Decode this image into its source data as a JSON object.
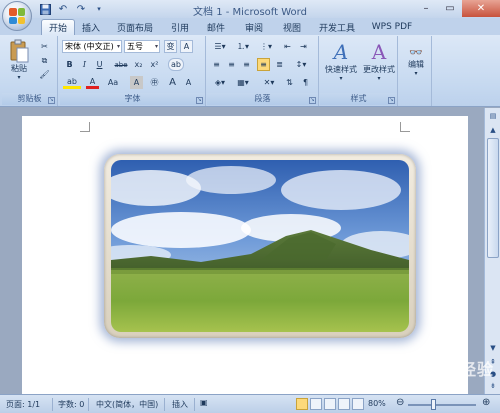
{
  "window": {
    "title": "文档 1 - Microsoft Word"
  },
  "tabs": [
    "开始",
    "插入",
    "页面布局",
    "引用",
    "邮件",
    "审阅",
    "视图",
    "开发工具",
    "WPS PDF"
  ],
  "ribbon": {
    "clipboard": {
      "paste_label": "粘贴",
      "group_label": "剪贴板"
    },
    "font": {
      "font_name": "宋体 (中文正)",
      "font_size": "五号",
      "group_label": "字体",
      "buttons": [
        "B",
        "I",
        "U",
        "abe",
        "x₂",
        "x²",
        "A",
        "Aa",
        "A",
        "A",
        "A"
      ]
    },
    "paragraph": {
      "group_label": "段落"
    },
    "styles": {
      "quick_styles_label": "快速样式",
      "change_styles_label": "更改样式",
      "group_label": "样式"
    },
    "editing": {
      "label": "编辑"
    }
  },
  "statusbar": {
    "page": "页面: 1/1",
    "words": "字数: 0",
    "language": "中文(简体，中国)",
    "mode": "插入",
    "zoom": "80%",
    "zoom_level": 0.8
  },
  "watermark": "Baidu 经验",
  "colors": {
    "accent": "#1e395b",
    "ribbon": "#c6d9f0",
    "tab_active": "#fbfdff"
  }
}
